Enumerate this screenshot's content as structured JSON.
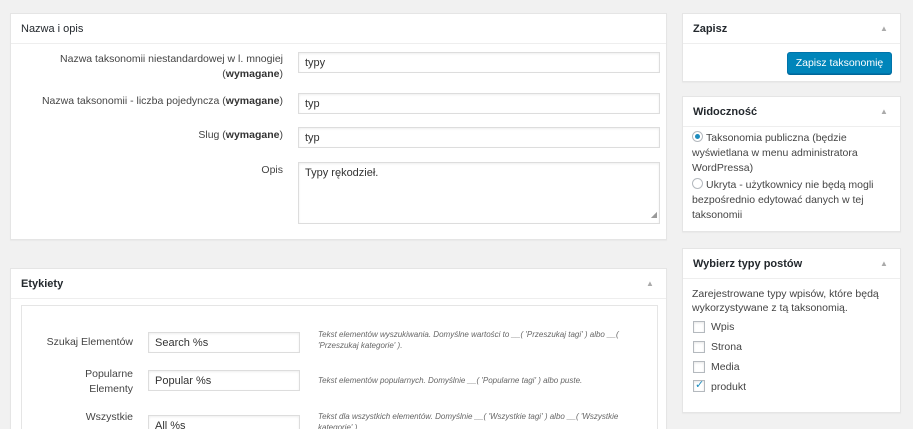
{
  "name_box": {
    "title": "Nazwa i opis",
    "plural_label": "Nazwa taksonomii niestandardowej w l. mnogiej",
    "required": "wymagane",
    "plural_value": "typy",
    "singular_label": "Nazwa taksonomii - liczba pojedyncza",
    "singular_value": "typ",
    "slug_label": "Slug",
    "slug_value": "typ",
    "desc_label": "Opis",
    "desc_value": "Typy rękodzieł."
  },
  "labels_box": {
    "title": "Etykiety",
    "rows": [
      {
        "label": "Szukaj Elementów",
        "value": "Search %s",
        "help": "Tekst elementów wyszukiwania. Domyślne wartości to __( 'Przeszukaj tagi' ) albo __( 'Przeszukaj kategorie' )."
      },
      {
        "label1": "Popularne",
        "label2": "Elementy",
        "value": "Popular %s",
        "help": "Tekst elementów popularnych. Domyślnie __( 'Popularne tagi' ) albo puste."
      },
      {
        "label": "Wszystkie",
        "value": "All %s",
        "help": "Tekst dla wszystkich elementów. Domyślnie __( 'Wszystkie tagi' ) albo __( 'Wszystkie kategorie' )."
      }
    ]
  },
  "save_box": {
    "title": "Zapisz",
    "button": "Zapisz taksonomię"
  },
  "visibility_box": {
    "title": "Widoczność",
    "public_l1": "Taksonomia publiczna (będzie",
    "public_l2": "wyświetlana w menu administratora",
    "public_l3": "WordPressa)",
    "hidden_l1": "Ukryta - użytkownicy nie będą mogli",
    "hidden_l2": "bezpośrednio edytować danych w tej",
    "hidden_l3": "taksonomii"
  },
  "post_types_box": {
    "title": "Wybierz typy postów",
    "desc_l1": "Zarejestrowane typy wpisów, które będą",
    "desc_l2": "wykorzystywane z tą taksonomią.",
    "items": [
      {
        "label": "Wpis",
        "checked": false
      },
      {
        "label": "Strona",
        "checked": false
      },
      {
        "label": "Media",
        "checked": false
      },
      {
        "label": "produkt",
        "checked": true
      }
    ]
  }
}
